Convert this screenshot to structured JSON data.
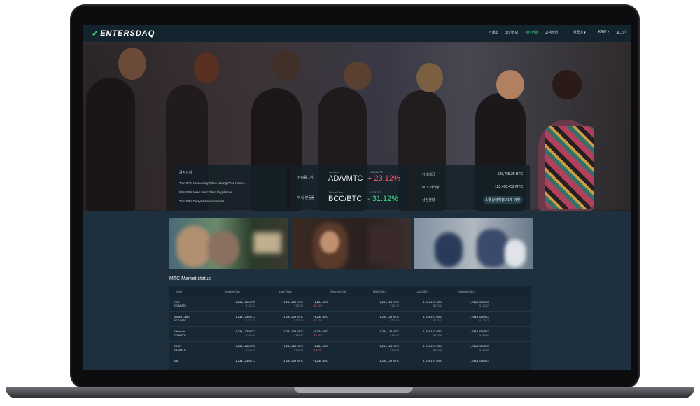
{
  "brand": {
    "logo_text": "ENTERSDAQ",
    "accent": "#3ddc84"
  },
  "nav": {
    "items": [
      "거래소",
      "코인정보",
      "상장현황",
      "고객센터",
      "한국어 ▾",
      "KRW ▾",
      "로그인"
    ],
    "active_index": 2
  },
  "hero": {
    "notice": {
      "title": "공지사항",
      "rows": [
        "Tron SPM New Listing Token Issuing Price Notice...",
        "BitIn SPM New Listed Token Regulations...",
        "Tron SPM Delayed Announcement"
      ]
    },
    "rank": {
      "rows": [
        {
          "label": "상승률 1위",
          "small": "Cardano",
          "pair": "ADA/MTC",
          "pct_label": "+1,234 MTC",
          "pct": "+ 23.12%",
          "pct_color": "#ff5a6a"
        },
        {
          "label": "하락 변동률",
          "small": "Bitcoin Cash",
          "pair": "BCC/BTC",
          "pct_label": "-1,234 BTC",
          "pct": "- 31.12%",
          "pct_color": "#3ddc84"
        }
      ]
    },
    "stats": {
      "rows": [
        {
          "k": "거래대금",
          "v": "123,765.25 BTC"
        },
        {
          "k": "MTC거래량",
          "v": "123,456,452 MTC"
        },
        {
          "k": "상장현황",
          "v": "1개 상장예정 / 1개 마켓"
        }
      ]
    }
  },
  "market": {
    "title": "MTC Market status",
    "headers": [
      "Coin",
      "Market Cap",
      "Last Price",
      "Change(24h)",
      "High(24h)",
      "Low(24h)",
      "Volume(24h)"
    ],
    "rows": [
      {
        "coin": [
          "EOS",
          "EOS/MTC"
        ],
        "cap": "1,234,123 MTC",
        "cap_sub": "$ 123.12",
        "last": "1,234,123 MTC",
        "last_sub": "$ 123.12",
        "chg": "+1,234 MTC",
        "chg_sub": "+23.12%",
        "high": "1,234,123 MTC",
        "high_sub": "$ 123.12",
        "low": "1,234,123 MTC",
        "low_sub": "$ 123.12",
        "vol": "1,234,123 MTC",
        "vol_sub": "$ 123.12"
      },
      {
        "coin": [
          "Bitcoin Cash",
          "BCC/MTC"
        ],
        "cap": "1,234,123 MTC",
        "cap_sub": "$ 123.12",
        "last": "1,234,123 MTC",
        "last_sub": "$ 123.12",
        "chg": "+1,234 MTC",
        "chg_sub": "+23.12%",
        "high": "1,234,123 MTC",
        "high_sub": "$ 123.12",
        "low": "1,234,123 MTC",
        "low_sub": "$ 123.12",
        "vol": "1,234,123 MTC",
        "vol_sub": "$ 123.12"
      },
      {
        "coin": [
          "Ethereum",
          "ETH/MTC"
        ],
        "cap": "1,234,123 MTC",
        "cap_sub": "$ 123.12",
        "last": "1,234,123 MTC",
        "last_sub": "$ 123.12",
        "chg": "+1,234 MTC",
        "chg_sub": "+23.12%",
        "high": "1,234,123 MTC",
        "high_sub": "$ 123.12",
        "low": "1,234,123 MTC",
        "low_sub": "$ 123.12",
        "vol": "1,234,123 MTC",
        "vol_sub": "$ 123.12"
      },
      {
        "coin": [
          "TRON",
          "TRX/MTC"
        ],
        "cap": "1,234,123 MTC",
        "cap_sub": "$ 123.12",
        "last": "1,234,123 MTC",
        "last_sub": "$ 123.12",
        "chg": "+1,234 MTC",
        "chg_sub": "+1.12%",
        "high": "1,234,123 MTC",
        "high_sub": "$ 123.12",
        "low": "1,234,123 MTC",
        "low_sub": "$ 123.12",
        "vol": "1,234,123 MTC",
        "vol_sub": "$ 123.12"
      },
      {
        "coin": [
          "Ada",
          ""
        ],
        "cap": "1,234,123 MTC",
        "cap_sub": "",
        "last": "1,234,123 MTC",
        "last_sub": "",
        "chg": "+1,234 MTC",
        "chg_sub": "",
        "high": "1,234,123 MTC",
        "high_sub": "",
        "low": "1,234,123 MTC",
        "low_sub": "",
        "vol": "1,234,123 MTC",
        "vol_sub": ""
      }
    ]
  },
  "colors": {
    "up": "#ff5a6a",
    "down": "#3ddc84",
    "bg": "#1e2f3d"
  }
}
